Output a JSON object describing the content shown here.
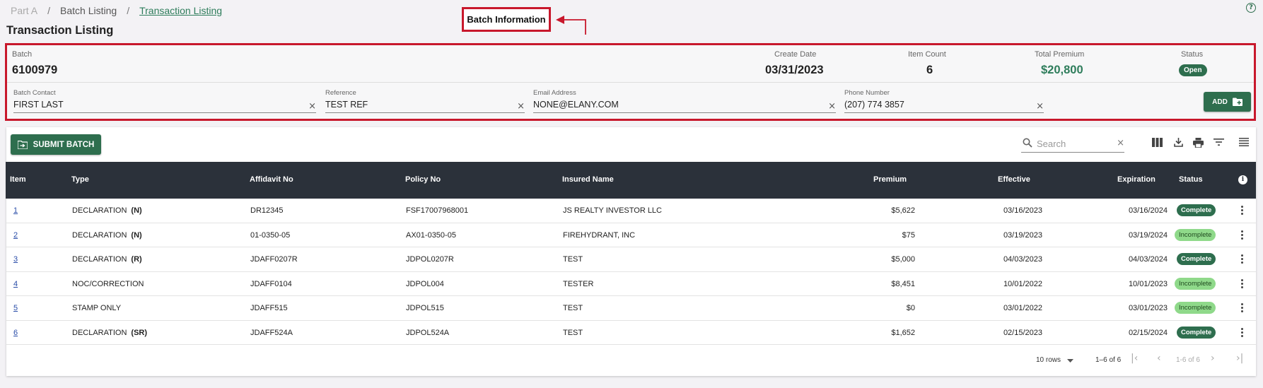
{
  "breadcrumb": {
    "items": [
      "Part A",
      "Batch Listing",
      "Transaction Listing"
    ],
    "separator": "/"
  },
  "page_title": "Transaction Listing",
  "annotation": {
    "callout_label": "Batch Information",
    "color": "#c8182c"
  },
  "batch": {
    "batch_label": "Batch",
    "batch_value": "6100979",
    "create_date_label": "Create Date",
    "create_date_value": "03/31/2023",
    "item_count_label": "Item Count",
    "item_count_value": "6",
    "total_premium_label": "Total Premium",
    "total_premium_value": "$20,800",
    "status_label": "Status",
    "status_value": "Open",
    "contact_label": "Batch Contact",
    "contact_value": "FIRST LAST",
    "reference_label": "Reference",
    "reference_value": "TEST REF",
    "email_label": "Email Address",
    "email_value": "NONE@ELANY.COM",
    "phone_label": "Phone Number",
    "phone_value": "(207) 774 3857",
    "add_label": "ADD"
  },
  "toolbar": {
    "submit_label": "SUBMIT BATCH",
    "search_placeholder": "Search",
    "icons": [
      "columns-icon",
      "download-icon",
      "print-icon",
      "filter-icon",
      "density-icon"
    ]
  },
  "table": {
    "columns": [
      "Item",
      "Type",
      "Affidavit No",
      "Policy No",
      "Insured Name",
      "Premium",
      "Effective",
      "Expiration",
      "Status"
    ],
    "rows": [
      {
        "item": "1",
        "type": "DECLARATION",
        "code": "(N)",
        "affidavit": "DR12345",
        "policy": "FSF17007968001",
        "insured": "JS REALTY INVESTOR LLC",
        "premium": "$5,622",
        "effective": "03/16/2023",
        "expiration": "03/16/2024",
        "status": "Complete"
      },
      {
        "item": "2",
        "type": "DECLARATION",
        "code": "(N)",
        "affidavit": "01-0350-05",
        "policy": "AX01-0350-05",
        "insured": "FIREHYDRANT, INC",
        "premium": "$75",
        "effective": "03/19/2023",
        "expiration": "03/19/2024",
        "status": "Incomplete"
      },
      {
        "item": "3",
        "type": "DECLARATION",
        "code": "(R)",
        "affidavit": "JDAFF0207R",
        "policy": "JDPOL0207R",
        "insured": "TEST",
        "premium": "$5,000",
        "effective": "04/03/2023",
        "expiration": "04/03/2024",
        "status": "Complete"
      },
      {
        "item": "4",
        "type": "NOC/CORRECTION",
        "code": "",
        "affidavit": "JDAFF0104",
        "policy": "JDPOL004",
        "insured": "TESTER",
        "premium": "$8,451",
        "effective": "10/01/2022",
        "expiration": "10/01/2023",
        "status": "Incomplete"
      },
      {
        "item": "5",
        "type": "STAMP ONLY",
        "code": "",
        "affidavit": "JDAFF515",
        "policy": "JDPOL515",
        "insured": "TEST",
        "premium": "$0",
        "effective": "03/01/2022",
        "expiration": "03/01/2023",
        "status": "Incomplete"
      },
      {
        "item": "6",
        "type": "DECLARATION",
        "code": "(SR)",
        "affidavit": "JDAFF524A",
        "policy": "JDPOL524A",
        "insured": "TEST",
        "premium": "$1,652",
        "effective": "02/15/2023",
        "expiration": "02/15/2024",
        "status": "Complete"
      }
    ]
  },
  "pagination": {
    "rows_per_page": "10 rows",
    "range_label": "1–6 of 6",
    "page_label": "1-6 of 6"
  },
  "colors": {
    "accent": "#2e6e4e",
    "header_bg": "#2b313a",
    "complete": "#2e6e4e",
    "incomplete": "#8fd98a",
    "premium_green": "#2e7d5b"
  }
}
